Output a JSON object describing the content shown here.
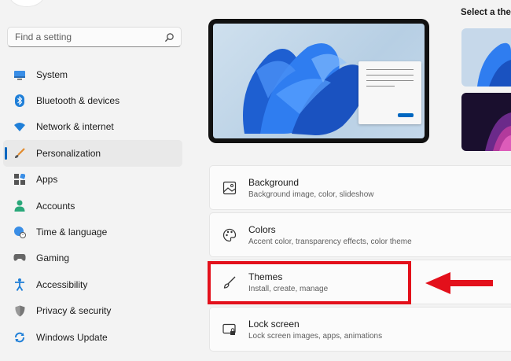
{
  "search": {
    "placeholder": "Find a setting"
  },
  "sidebar": {
    "items": [
      {
        "label": "System",
        "icon": "monitor-icon"
      },
      {
        "label": "Bluetooth & devices",
        "icon": "bluetooth-icon"
      },
      {
        "label": "Network & internet",
        "icon": "wifi-icon"
      },
      {
        "label": "Personalization",
        "icon": "brush-icon",
        "active": true
      },
      {
        "label": "Apps",
        "icon": "apps-icon"
      },
      {
        "label": "Accounts",
        "icon": "person-icon"
      },
      {
        "label": "Time & language",
        "icon": "globe-clock-icon"
      },
      {
        "label": "Gaming",
        "icon": "gamepad-icon"
      },
      {
        "label": "Accessibility",
        "icon": "accessibility-icon"
      },
      {
        "label": "Privacy & security",
        "icon": "shield-icon"
      },
      {
        "label": "Windows Update",
        "icon": "update-icon"
      }
    ]
  },
  "theme_panel": {
    "label": "Select a ther"
  },
  "cards": [
    {
      "title": "Background",
      "subtitle": "Background image, color, slideshow",
      "icon": "image-icon"
    },
    {
      "title": "Colors",
      "subtitle": "Accent color, transparency effects, color theme",
      "icon": "palette-icon"
    },
    {
      "title": "Themes",
      "subtitle": "Install, create, manage",
      "icon": "brush-icon"
    },
    {
      "title": "Lock screen",
      "subtitle": "Lock screen images, apps, animations",
      "icon": "lock-screen-icon"
    }
  ],
  "colors": {
    "accent": "#0067c0",
    "annotation": "#e3101b"
  }
}
